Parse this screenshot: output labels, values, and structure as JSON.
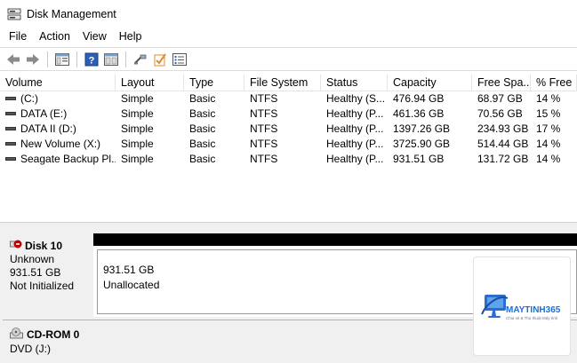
{
  "window": {
    "title": "Disk Management"
  },
  "menu": [
    "File",
    "Action",
    "View",
    "Help"
  ],
  "toolbar": {
    "buttons": [
      "back-icon",
      "forward-icon",
      "console-tree-icon",
      "help-icon",
      "properties-icon",
      "connect-icon",
      "check-icon",
      "list-icon"
    ]
  },
  "volumes": {
    "columns": [
      "Volume",
      "Layout",
      "Type",
      "File System",
      "Status",
      "Capacity",
      "Free Spa...",
      "% Free"
    ],
    "rows": [
      [
        "(C:)",
        "Simple",
        "Basic",
        "NTFS",
        "Healthy (S...",
        "476.94 GB",
        "68.97 GB",
        "14 %"
      ],
      [
        "DATA (E:)",
        "Simple",
        "Basic",
        "NTFS",
        "Healthy (P...",
        "461.36 GB",
        "70.56 GB",
        "15 %"
      ],
      [
        "DATA II (D:)",
        "Simple",
        "Basic",
        "NTFS",
        "Healthy (P...",
        "1397.26 GB",
        "234.93 GB",
        "17 %"
      ],
      [
        "New Volume (X:)",
        "Simple",
        "Basic",
        "NTFS",
        "Healthy (P...",
        "3725.90 GB",
        "514.44 GB",
        "14 %"
      ],
      [
        "Seagate Backup Pl...",
        "Simple",
        "Basic",
        "NTFS",
        "Healthy (P...",
        "931.51 GB",
        "131.72 GB",
        "14 %"
      ]
    ]
  },
  "disks": [
    {
      "name": "Disk 10",
      "kind": "Unknown",
      "size": "931.51 GB",
      "state": "Not Initialized",
      "partition": {
        "size": "931.51 GB",
        "status": "Unallocated"
      }
    },
    {
      "name": "CD-ROM 0",
      "kind": "DVD (J:)"
    }
  ],
  "watermark": {
    "brand": "MAYTINH365",
    "tagline": "Chia sẻ & Thủ thuật Máy tính"
  },
  "colors": {
    "unallocated_bar": "#000000",
    "brand": "#1a6fd6",
    "error": "#c00000"
  }
}
